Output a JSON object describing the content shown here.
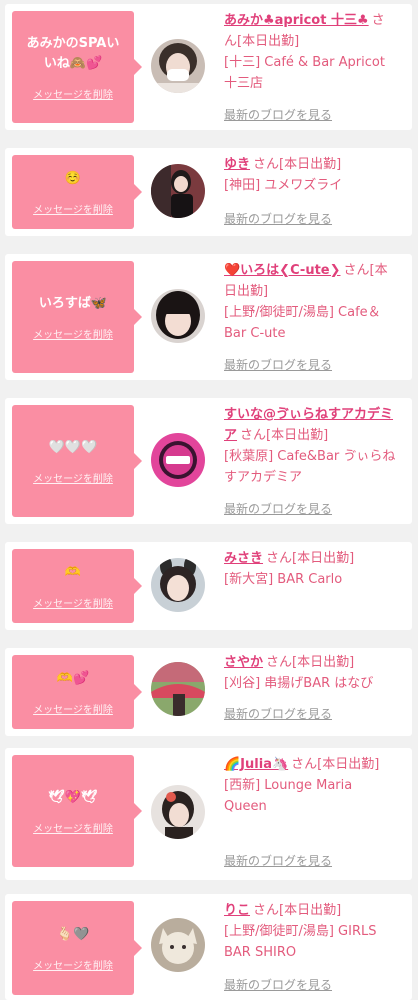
{
  "delete_label": "メッセージを削除",
  "blog_label": "最新のブログを見る",
  "status_suffix": "さん[本日出勤]",
  "cards": [
    {
      "message": "あみかのSPAいいね🙈💕",
      "name": "あみか♣apricot 十三♣",
      "shop": "[十三] Café & Bar Apricot 十三店"
    },
    {
      "message": "☺️",
      "name": "ゆき",
      "shop": "[神田] ユメワズライ"
    },
    {
      "message": "いろすば🦋",
      "name": "❤️いろは❮C-ute❯",
      "shop": "[上野/御徒町/湯島] Cafe＆Bar C-ute"
    },
    {
      "message": "🤍🤍🤍",
      "name": "すいな@ゔぃらねすアカデミア",
      "shop": "[秋葉原] Cafe&Bar ゔぃらねすアカデミア"
    },
    {
      "message": "🫶",
      "name": "みさき",
      "shop": "[新大宮] BAR Carlo"
    },
    {
      "message": "🫶💕",
      "name": "さやか",
      "shop": "[刈谷] 串揚げBAR はなび"
    },
    {
      "message": "🕊💖🕊",
      "name": "🌈Julia🦄",
      "shop": "[西新] Lounge Maria Queen"
    },
    {
      "message": "🫰🏻🩶",
      "name": "りこ",
      "shop": "[上野/御徒町/湯島] GIRLS BAR SHIRO"
    }
  ],
  "colors": {
    "bubble": "#fa8ea3",
    "name": "#e0407a",
    "text": "#e35b7d",
    "link": "#9a9a9a"
  },
  "avatar_icons": [
    "girl-white-mask-avatar",
    "girl-black-outfit-avatar",
    "girl-bangs-avatar",
    "pink-logo-avatar",
    "girl-bunny-ears-avatar",
    "bridge-photo-avatar",
    "girl-hair-accessory-avatar",
    "fox-mask-avatar"
  ]
}
